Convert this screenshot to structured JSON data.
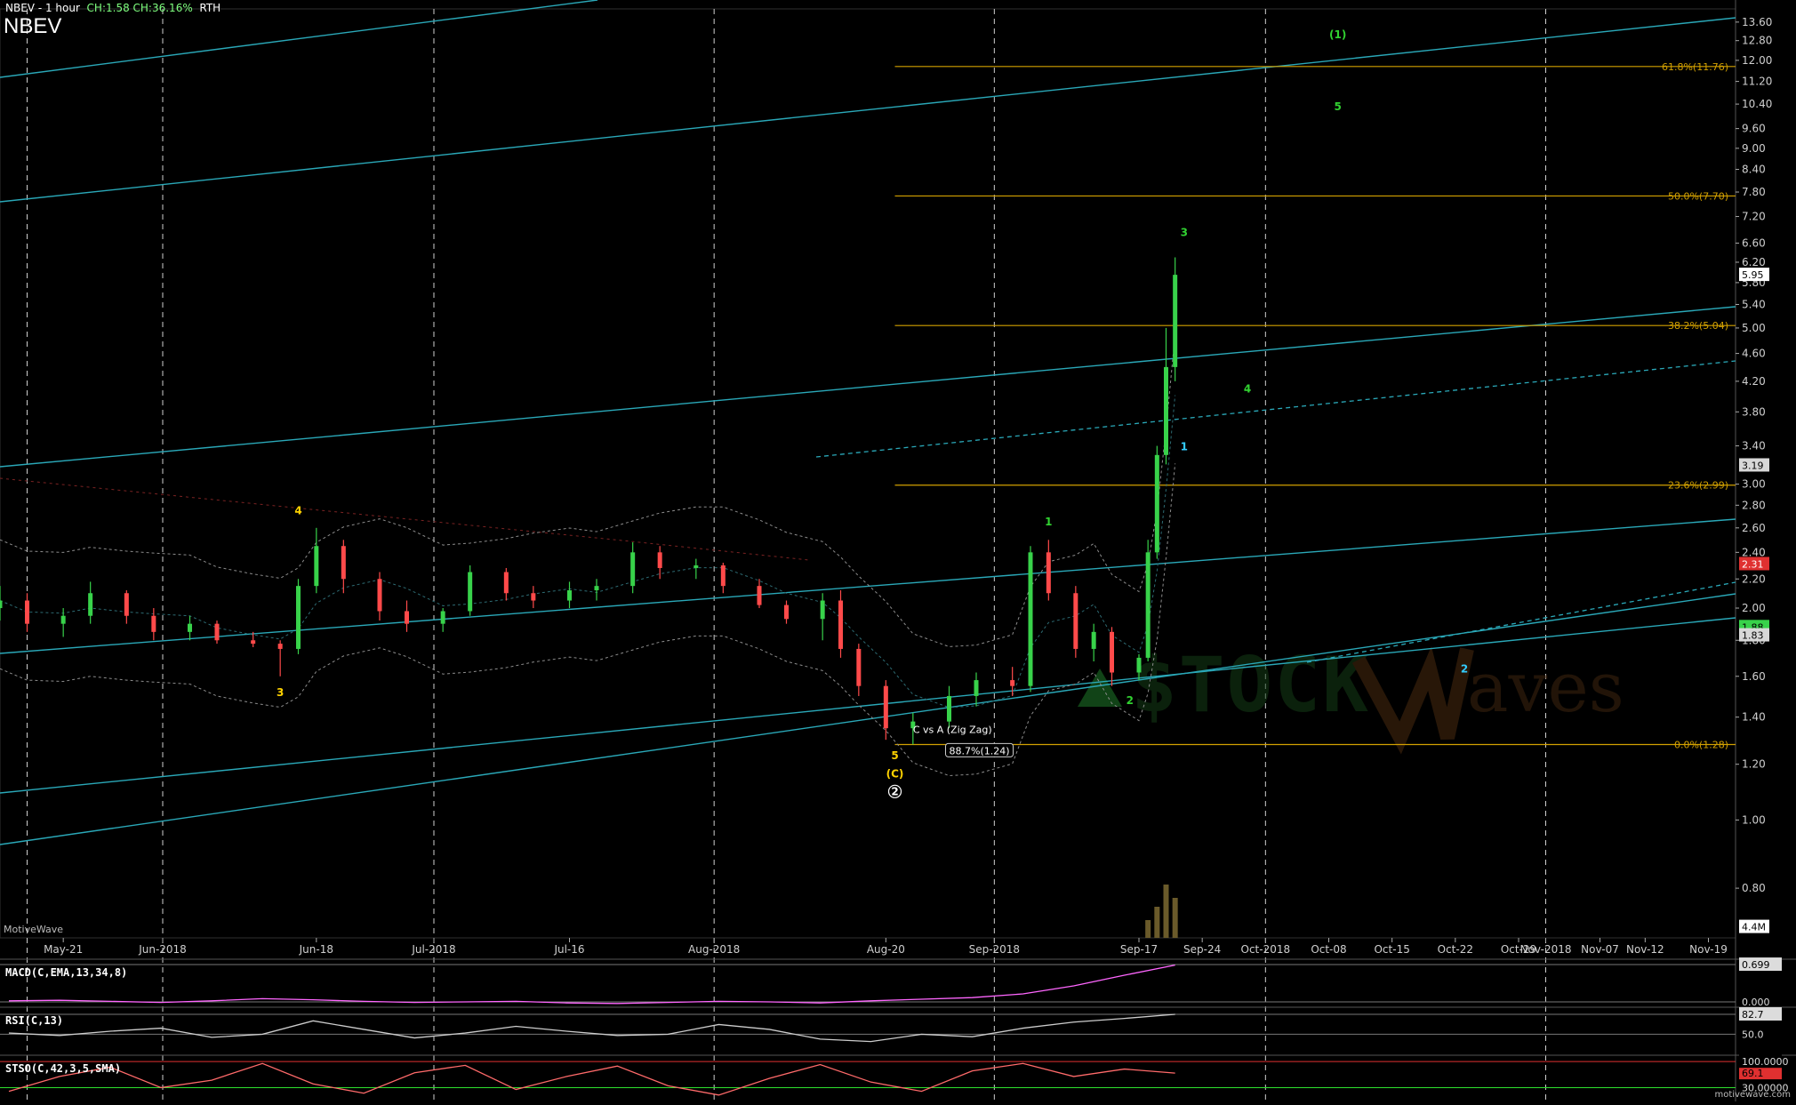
{
  "header": {
    "title": "NBEV - 1 hour",
    "change": "CH:1.58  CH:36.16%",
    "session": "RTH",
    "symbol": "NBEV"
  },
  "footer": {
    "brand": "MotiveWave",
    "site": "motivewave.com"
  },
  "watermark": {
    "text1": "$TOCK",
    "text2": "aves"
  },
  "colors": {
    "background": "#000000",
    "up_candle": "#38d24a",
    "down_candle": "#ff4a4a",
    "fib_line": "#d2a000",
    "channel_line": "#2aa8b8",
    "wave_green": "#31d231",
    "wave_yellow": "#ffd200",
    "wave_cyan": "#33ccff",
    "bollinger": "#8c8c8c",
    "macd_line": "#ff66ff",
    "rsi_line": "#cccccc",
    "stoch_line": "#ff6a6a"
  },
  "chart_data": [
    {
      "type": "candlestick",
      "title": "NBEV - 1 hour",
      "y_scale": "log",
      "ylim": [
        0.68,
        14.2
      ],
      "y_ticks": [
        "13.60",
        "12.80",
        "12.00",
        "11.20",
        "10.40",
        "9.60",
        "9.00",
        "8.40",
        "7.80",
        "7.20",
        "6.60",
        "6.20",
        "5.80",
        "5.40",
        "5.00",
        "4.60",
        "4.20",
        "3.80",
        "3.40",
        "3.00",
        "2.80",
        "2.60",
        "2.40",
        "2.20",
        "2.00",
        "1.80",
        "1.60",
        "1.40",
        "1.20",
        "1.00",
        "0.80"
      ],
      "x_ticks": [
        "May-21",
        "Jun-2018",
        "Jun-18",
        "Jul-2018",
        "Jul-16",
        "Aug-2018",
        "Aug-20",
        "Sep-2018",
        "Sep-17",
        "Sep-24",
        "Oct-2018",
        "Oct-08",
        "Oct-15",
        "Oct-22",
        "Oct-29",
        "Nov-2018",
        "Nov-07",
        "Nov-12",
        "Nov-19"
      ],
      "series": [
        {
          "values": [
            {
              "date": "2018-05-14",
              "o": 2.0,
              "h": 2.15,
              "l": 1.92,
              "c": 2.05
            },
            {
              "date": "2018-05-17",
              "o": 2.05,
              "h": 2.1,
              "l": 1.85,
              "c": 1.9
            },
            {
              "date": "2018-05-21",
              "o": 1.9,
              "h": 2.0,
              "l": 1.82,
              "c": 1.95
            },
            {
              "date": "2018-05-24",
              "o": 1.95,
              "h": 2.18,
              "l": 1.9,
              "c": 2.1
            },
            {
              "date": "2018-05-28",
              "o": 2.1,
              "h": 2.12,
              "l": 1.9,
              "c": 1.95
            },
            {
              "date": "2018-05-31",
              "o": 1.95,
              "h": 2.0,
              "l": 1.8,
              "c": 1.85
            },
            {
              "date": "2018-06-04",
              "o": 1.85,
              "h": 1.95,
              "l": 1.8,
              "c": 1.9
            },
            {
              "date": "2018-06-07",
              "o": 1.9,
              "h": 1.92,
              "l": 1.78,
              "c": 1.8
            },
            {
              "date": "2018-06-11",
              "o": 1.8,
              "h": 1.85,
              "l": 1.76,
              "c": 1.78
            },
            {
              "date": "2018-06-14",
              "o": 1.78,
              "h": 1.8,
              "l": 1.6,
              "c": 1.75
            },
            {
              "date": "2018-06-16",
              "o": 1.75,
              "h": 2.2,
              "l": 1.72,
              "c": 2.15
            },
            {
              "date": "2018-06-18",
              "o": 2.15,
              "h": 2.6,
              "l": 2.1,
              "c": 2.45
            },
            {
              "date": "2018-06-21",
              "o": 2.45,
              "h": 2.5,
              "l": 2.1,
              "c": 2.2
            },
            {
              "date": "2018-06-25",
              "o": 2.2,
              "h": 2.25,
              "l": 1.92,
              "c": 1.98
            },
            {
              "date": "2018-06-28",
              "o": 1.98,
              "h": 2.05,
              "l": 1.85,
              "c": 1.9
            },
            {
              "date": "2018-07-02",
              "o": 1.9,
              "h": 2.0,
              "l": 1.85,
              "c": 1.98
            },
            {
              "date": "2018-07-05",
              "o": 1.98,
              "h": 2.3,
              "l": 1.95,
              "c": 2.25
            },
            {
              "date": "2018-07-09",
              "o": 2.25,
              "h": 2.28,
              "l": 2.05,
              "c": 2.1
            },
            {
              "date": "2018-07-12",
              "o": 2.1,
              "h": 2.15,
              "l": 2.0,
              "c": 2.05
            },
            {
              "date": "2018-07-16",
              "o": 2.05,
              "h": 2.18,
              "l": 2.0,
              "c": 2.12
            },
            {
              "date": "2018-07-19",
              "o": 2.12,
              "h": 2.2,
              "l": 2.05,
              "c": 2.15
            },
            {
              "date": "2018-07-23",
              "o": 2.15,
              "h": 2.48,
              "l": 2.1,
              "c": 2.4
            },
            {
              "date": "2018-07-26",
              "o": 2.4,
              "h": 2.45,
              "l": 2.2,
              "c": 2.28
            },
            {
              "date": "2018-07-30",
              "o": 2.28,
              "h": 2.35,
              "l": 2.2,
              "c": 2.3
            },
            {
              "date": "2018-08-02",
              "o": 2.3,
              "h": 2.32,
              "l": 2.1,
              "c": 2.15
            },
            {
              "date": "2018-08-06",
              "o": 2.15,
              "h": 2.2,
              "l": 2.0,
              "c": 2.02
            },
            {
              "date": "2018-08-09",
              "o": 2.02,
              "h": 2.05,
              "l": 1.9,
              "c": 1.93
            },
            {
              "date": "2018-08-13",
              "o": 1.93,
              "h": 2.1,
              "l": 1.8,
              "c": 2.05
            },
            {
              "date": "2018-08-15",
              "o": 2.05,
              "h": 2.12,
              "l": 1.7,
              "c": 1.75
            },
            {
              "date": "2018-08-17",
              "o": 1.75,
              "h": 1.78,
              "l": 1.5,
              "c": 1.55
            },
            {
              "date": "2018-08-20",
              "o": 1.55,
              "h": 1.58,
              "l": 1.3,
              "c": 1.35
            },
            {
              "date": "2018-08-23",
              "o": 1.35,
              "h": 1.42,
              "l": 1.28,
              "c": 1.38
            },
            {
              "date": "2018-08-27",
              "o": 1.38,
              "h": 1.55,
              "l": 1.35,
              "c": 1.5
            },
            {
              "date": "2018-08-30",
              "o": 1.5,
              "h": 1.62,
              "l": 1.45,
              "c": 1.58
            },
            {
              "date": "2018-09-03",
              "o": 1.58,
              "h": 1.65,
              "l": 1.5,
              "c": 1.55
            },
            {
              "date": "2018-09-05",
              "o": 1.55,
              "h": 2.45,
              "l": 1.52,
              "c": 2.4
            },
            {
              "date": "2018-09-07",
              "o": 2.4,
              "h": 2.5,
              "l": 2.05,
              "c": 2.1
            },
            {
              "date": "2018-09-10",
              "o": 2.1,
              "h": 2.15,
              "l": 1.7,
              "c": 1.75
            },
            {
              "date": "2018-09-12",
              "o": 1.75,
              "h": 1.9,
              "l": 1.68,
              "c": 1.85
            },
            {
              "date": "2018-09-14",
              "o": 1.85,
              "h": 1.88,
              "l": 1.55,
              "c": 1.62
            },
            {
              "date": "2018-09-17",
              "o": 1.62,
              "h": 1.72,
              "l": 1.58,
              "c": 1.7
            },
            {
              "date": "2018-09-18",
              "o": 1.7,
              "h": 2.5,
              "l": 1.68,
              "c": 2.4
            },
            {
              "date": "2018-09-19",
              "o": 2.4,
              "h": 3.4,
              "l": 2.35,
              "c": 3.3
            },
            {
              "date": "2018-09-20",
              "o": 3.3,
              "h": 5.0,
              "l": 3.2,
              "c": 4.4
            },
            {
              "date": "2018-09-21",
              "o": 4.4,
              "h": 6.3,
              "l": 4.2,
              "c": 5.95
            }
          ]
        }
      ],
      "fib_levels": [
        {
          "label": "61.8%(11.76)",
          "value": 11.76
        },
        {
          "label": "50.0%(7.70)",
          "value": 7.7
        },
        {
          "label": "38.2%(5.04)",
          "value": 5.04
        },
        {
          "label": "23.6%(2.99)",
          "value": 2.99
        },
        {
          "label": "0.0%(1.28)",
          "value": 1.28
        }
      ],
      "price_markers": [
        {
          "label": "5.95",
          "value": 5.95,
          "color": "#ffffff",
          "text_color": "#000000"
        },
        {
          "label": "3.19",
          "value": 3.19,
          "color": "#d8d8d8",
          "text_color": "#000000"
        },
        {
          "label": "2.31",
          "value": 2.31,
          "color": "#e03030",
          "text_color": "#ffffff"
        },
        {
          "label": "1.88",
          "value": 1.88,
          "color": "#38d24a",
          "text_color": "#000000"
        },
        {
          "label": "1.83",
          "value": 1.83,
          "color": "#d8d8d8",
          "text_color": "#000000"
        },
        {
          "label": "4.4M",
          "value": 0.705,
          "color": "#ffffff",
          "text_color": "#000000"
        }
      ],
      "wave_labels": [
        {
          "text": "(1)",
          "date": "2018-10-09",
          "value": 12.9,
          "color": "#31d231"
        },
        {
          "text": "5",
          "date": "2018-10-09",
          "value": 10.2,
          "color": "#31d231"
        },
        {
          "text": "3",
          "date": "2018-09-22",
          "value": 6.75,
          "color": "#31d231"
        },
        {
          "text": "4",
          "date": "2018-09-29",
          "value": 4.05,
          "color": "#31d231"
        },
        {
          "text": "1",
          "date": "2018-09-22",
          "value": 3.35,
          "color": "#33ccff"
        },
        {
          "text": "1",
          "date": "2018-09-07",
          "value": 2.62,
          "color": "#31d231"
        },
        {
          "text": "2",
          "date": "2018-09-16",
          "value": 1.46,
          "color": "#31d231"
        },
        {
          "text": "2",
          "date": "2018-10-23",
          "value": 1.62,
          "color": "#33ccff"
        },
        {
          "text": "4",
          "date": "2018-06-16",
          "value": 2.72,
          "color": "#ffd200"
        },
        {
          "text": "3",
          "date": "2018-06-14",
          "value": 1.5,
          "color": "#ffd200"
        },
        {
          "text": "5",
          "date": "2018-08-21",
          "value": 1.22,
          "color": "#ffd200"
        },
        {
          "text": "(C)",
          "date": "2018-08-21",
          "value": 1.15,
          "color": "#ffd200"
        },
        {
          "text": "2",
          "date": "2018-08-21",
          "value": 1.085,
          "color": "#ffffff",
          "circled": true
        }
      ],
      "annotations": [
        {
          "text": "C vs A (Zig Zag)",
          "date": "2018-08-23",
          "value": 1.33
        },
        {
          "text": "88.7%(1.24)",
          "date": "2018-08-27",
          "value": 1.24
        }
      ]
    },
    {
      "type": "line",
      "title": "MACD(C,EMA,13,34,8)",
      "ylim": [
        -0.05,
        0.75
      ],
      "y_ticks": [
        "0.699",
        "0.000"
      ],
      "series": [
        {
          "values": [
            0.02,
            0.03,
            0.01,
            -0.01,
            0.02,
            0.06,
            0.04,
            0.01,
            -0.01,
            0.0,
            0.01,
            -0.02,
            -0.03,
            -0.01,
            0.01,
            0.0,
            -0.02,
            0.02,
            0.05,
            0.08,
            0.15,
            0.3,
            0.5,
            0.69
          ]
        }
      ]
    },
    {
      "type": "line",
      "title": "RSI(C,13)",
      "ylim": [
        20,
        90
      ],
      "y_ticks": [
        "82.7",
        "50.0"
      ],
      "series": [
        {
          "values": [
            52,
            48,
            55,
            60,
            45,
            50,
            72,
            58,
            44,
            52,
            63,
            55,
            48,
            50,
            66,
            58,
            42,
            38,
            50,
            46,
            60,
            70,
            76,
            82.7
          ]
        }
      ]
    },
    {
      "type": "line",
      "title": "STSO(C,42,3,5,SMA)",
      "ylim": [
        0,
        110
      ],
      "y_ticks": [
        "69.1",
        "100.0000",
        "30.00000"
      ],
      "series": [
        {
          "values": [
            20,
            60,
            85,
            30,
            50,
            95,
            40,
            15,
            70,
            90,
            25,
            60,
            88,
            35,
            10,
            55,
            92,
            45,
            20,
            75,
            95,
            60,
            80,
            69.1
          ]
        }
      ]
    }
  ]
}
